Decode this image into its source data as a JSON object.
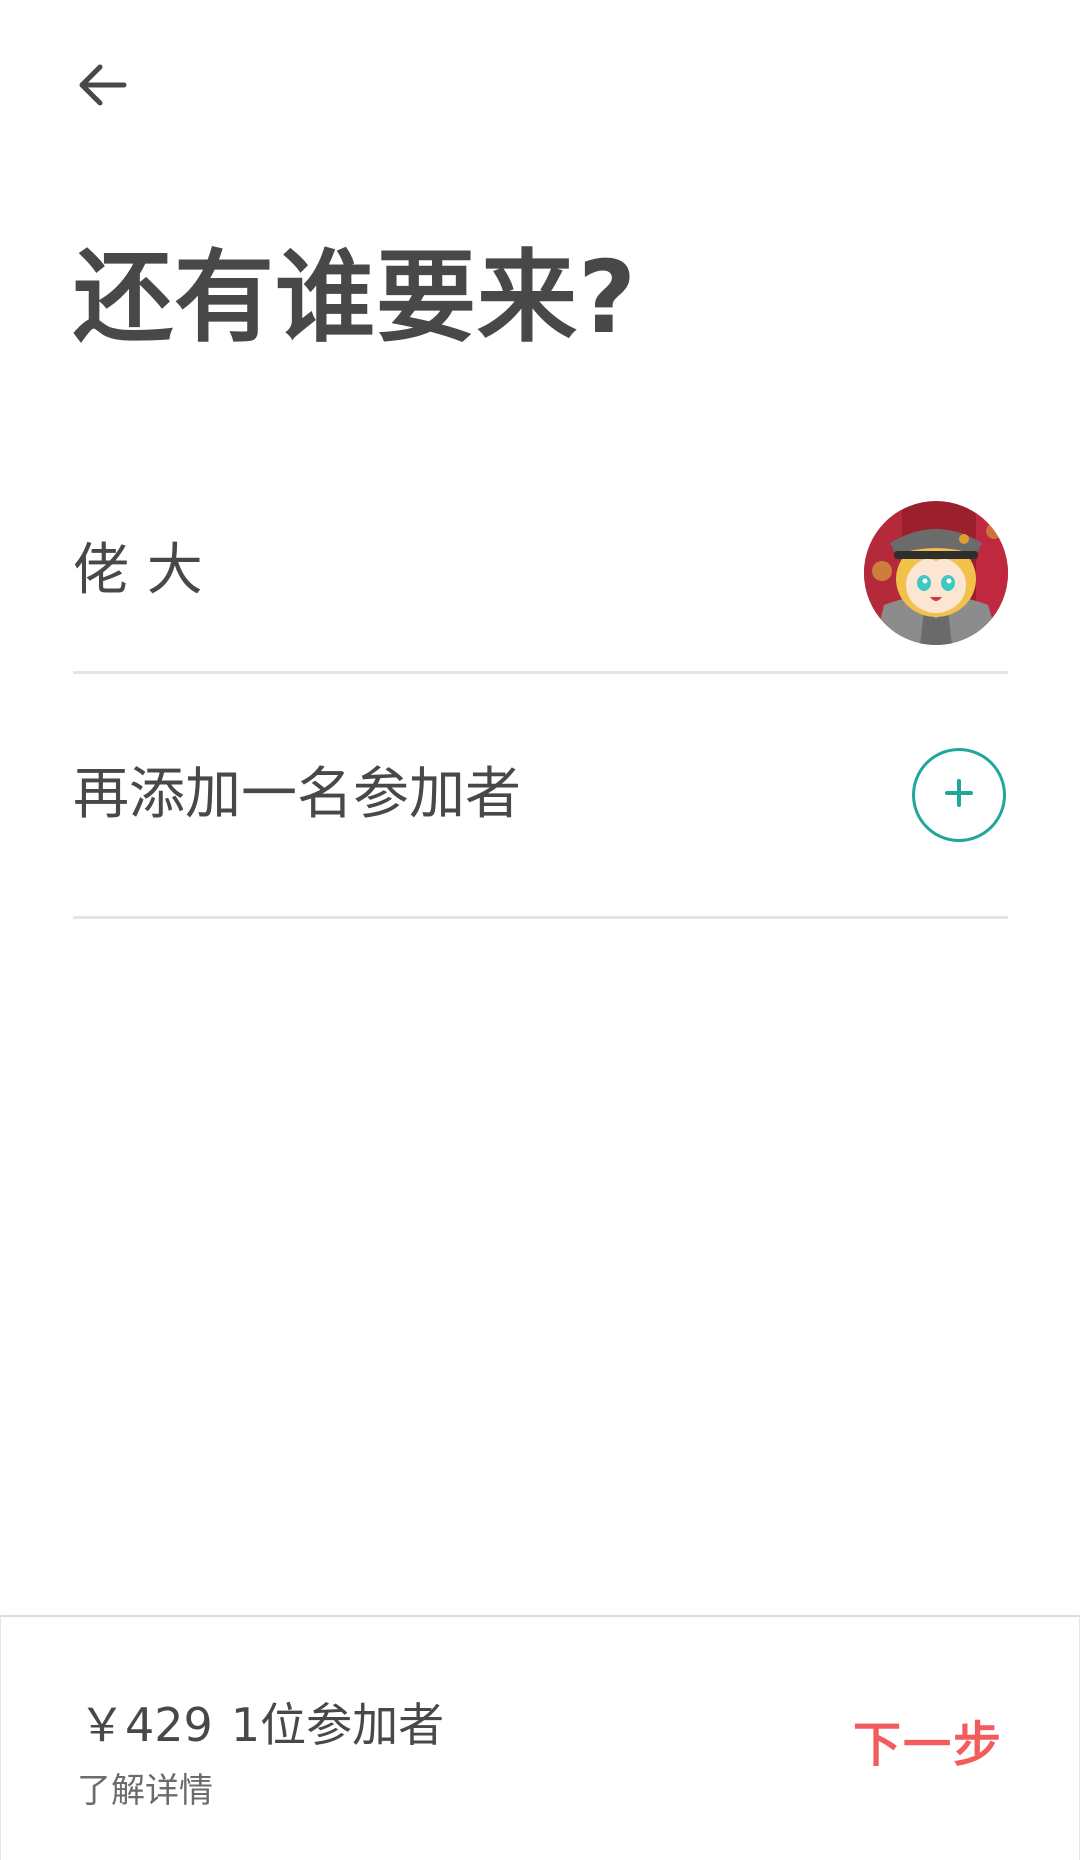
{
  "header": {
    "back_icon": "arrow-left-icon",
    "title": "还有谁要来?"
  },
  "guests": [
    {
      "name": "佬 大",
      "avatar": "anime-avatar"
    }
  ],
  "add_guest": {
    "label": "再添加一名参加者",
    "icon": "plus-icon"
  },
  "footer": {
    "price": "￥429",
    "guest_count": "1位参加者",
    "details_link": "了解详情",
    "next_label": "下一步"
  },
  "colors": {
    "accent": "#20a79a",
    "next": "#f25c5c",
    "text": "#484848"
  }
}
